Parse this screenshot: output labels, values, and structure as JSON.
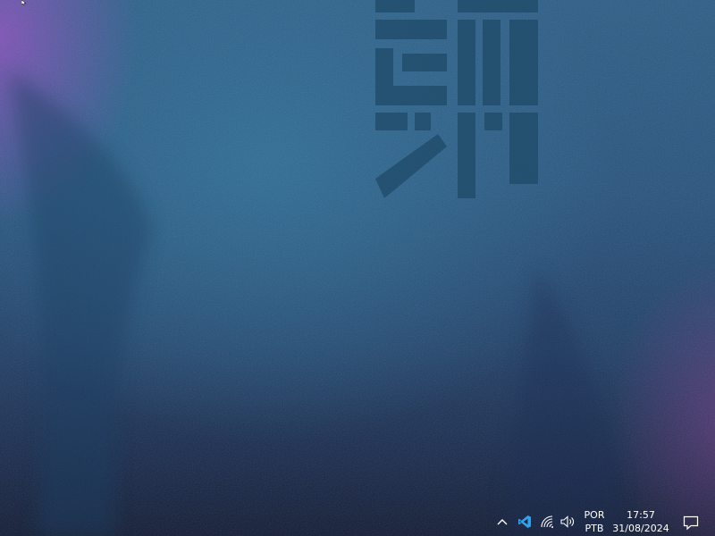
{
  "wallpaper": {
    "colors": {
      "top": "#2b5c86",
      "bottom": "#101a33",
      "purple_glow": "#8c50be",
      "magenta_glow": "#823c8c"
    }
  },
  "taskbar": {
    "tray": {
      "chevron_icon": "chevron-up-icon",
      "vscode_icon": "vscode-icon",
      "network_icon": "wifi-icon",
      "volume_icon": "speaker-icon",
      "language": {
        "line1": "POR",
        "line2": "PTB"
      },
      "clock": {
        "time": "17:57",
        "date": "31/08/2024"
      },
      "notification_icon": "notification-icon"
    },
    "colors": {
      "text": "#ffffff",
      "vscode": "#2fa3f0"
    }
  }
}
